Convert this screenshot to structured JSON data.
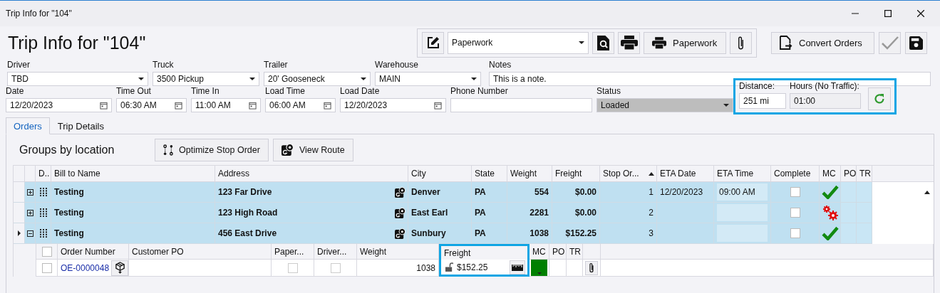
{
  "window": {
    "title": "Trip Info for \"104\""
  },
  "heading": "Trip Info for \"104\"",
  "toolbar": {
    "paperwork_combo": "Paperwork",
    "paperwork_button": "Paperwork",
    "convert_button": "Convert Orders"
  },
  "fields_row_1": [
    {
      "label": "Driver",
      "value": "TBD",
      "kind": "combo"
    },
    {
      "label": "Truck",
      "value": "3500 Pickup",
      "kind": "combo"
    },
    {
      "label": "Trailer",
      "value": "20' Gooseneck",
      "kind": "combo"
    },
    {
      "label": "Warehouse",
      "value": "MAIN",
      "kind": "combo"
    },
    {
      "label": "Notes",
      "value": "This is a note.",
      "kind": "text"
    }
  ],
  "fields_row_2": [
    {
      "label": "Date",
      "value": "12/20/2023",
      "kind": "date",
      "disabled": false
    },
    {
      "label": "Time Out",
      "value": "06:30 AM",
      "kind": "date",
      "disabled": false
    },
    {
      "label": "Time In",
      "value": "11:00 AM",
      "kind": "date",
      "disabled": false
    },
    {
      "label": "Load Time",
      "value": "06:00 AM",
      "kind": "date",
      "disabled": false
    },
    {
      "label": "Load Date",
      "value": "12/20/2023",
      "kind": "date",
      "disabled": false
    },
    {
      "label": "Phone Number",
      "kind": "text",
      "disabled": false
    },
    {
      "label": "Status",
      "value": "Loaded",
      "kind": "combo",
      "disabled": true
    }
  ],
  "distance_group": {
    "highlighted": true,
    "fields": [
      {
        "label": "Distance:",
        "value": "251 mi",
        "disabled": false
      },
      {
        "label": "Hours (No Traffic):",
        "value": "01:00",
        "disabled": true
      }
    ]
  },
  "tabs": [
    {
      "label": "Orders",
      "selected": true
    },
    {
      "label": "Trip Details",
      "selected": false
    }
  ],
  "groups_title": "Groups by location",
  "buttons": [
    "Optimize Stop Order",
    "View Route"
  ],
  "table": {
    "columns": [
      {
        "label": "D..",
        "sorted": false
      },
      {
        "label": "Bill to Name",
        "sorted": false
      },
      {
        "label": "Address",
        "sorted": false
      },
      {
        "label": "City",
        "sorted": false
      },
      {
        "label": "State",
        "sorted": false
      },
      {
        "label": "Weight",
        "sorted": false
      },
      {
        "label": "Freight",
        "sorted": false
      },
      {
        "label": "Stop Or...",
        "sorted": true
      },
      {
        "label": "ETA Date",
        "sorted": false
      },
      {
        "label": "ETA Time",
        "sorted": false
      },
      {
        "label": "Complete",
        "sorted": false
      },
      {
        "label": "MC",
        "sorted": false
      },
      {
        "label": "PO",
        "sorted": false
      },
      {
        "label": "TR",
        "sorted": false
      }
    ],
    "rows": [
      {
        "bill_to": "Testing",
        "address": "123 Far Drive",
        "city": "Denver",
        "state": "PA",
        "weight": "554",
        "freight": "$0.00",
        "stop_order": "1",
        "eta_date": "12/20/2023",
        "eta_time": "09:00 AM",
        "complete": false,
        "mc_ok": true,
        "expanded": false,
        "current": false,
        "selected": true
      },
      {
        "bill_to": "Testing",
        "address": "123 High Road",
        "city": "East Earl",
        "state": "PA",
        "weight": "2281",
        "freight": "$0.00",
        "stop_order": "2",
        "complete": false,
        "mc_ok": false,
        "expanded": false,
        "current": false,
        "selected": true
      },
      {
        "bill_to": "Testing",
        "address": "456 East Drive",
        "city": "Sunbury",
        "state": "PA",
        "weight": "1038",
        "freight": "$152.25",
        "stop_order": "3",
        "complete": false,
        "mc_ok": true,
        "expanded": true,
        "current": true,
        "selected": true
      }
    ]
  },
  "order_table": {
    "select_all": false,
    "columns": [
      {
        "label": "Order Number"
      },
      {
        "label": "Customer PO"
      },
      {
        "label": "Paper..."
      },
      {
        "label": "Driver..."
      },
      {
        "label": "Weight"
      },
      {
        "label": "Freight",
        "highlighted": true
      },
      {
        "label": "MC"
      },
      {
        "label": "PO"
      },
      {
        "label": "TR"
      }
    ],
    "rows": [
      {
        "selected": false,
        "order_number": "OE-0000048",
        "paperwork": false,
        "driver": false,
        "weight": "1038",
        "freight": "$152.25",
        "locked": false
      }
    ]
  }
}
